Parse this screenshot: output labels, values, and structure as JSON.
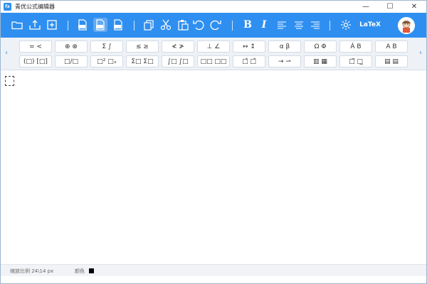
{
  "window": {
    "title": "青优公式编辑器",
    "logo_text": "fx",
    "controls": [
      "—",
      "☐",
      "✕"
    ]
  },
  "toolbar": {
    "icons": [
      "folder-open-icon",
      "export-icon",
      "new-document-icon",
      "save-png-icon",
      "save-svg-icon",
      "save-tex-icon",
      "copy-icon",
      "cut-icon",
      "paste-icon",
      "undo-icon",
      "redo-icon",
      "align-left-icon",
      "align-center-icon",
      "align-right-icon",
      "settings-gear-icon"
    ],
    "bold_label": "B",
    "italic_label": "I",
    "latex_label": "LaTeX",
    "accent_color": "#2f8ff0"
  },
  "palette": {
    "left_arrow": "‹",
    "right_arrow": "›",
    "row1": [
      "= <",
      "⊕ ⊗",
      "Σ ∫",
      "≤ ≥",
      "≮ ≯",
      "⊥ ∠",
      "↔ ↕",
      "α β",
      "Ω Φ",
      "Ȧ B",
      "A B"
    ],
    "row2": [
      "(□) [□]",
      "□/□",
      "□² □ₓ",
      "Σ□ Σ□",
      "∫□ ∫□",
      "□□ □□",
      "□̂ □̃",
      "→ ⇀",
      "▥ ▦",
      "□̅ □̲",
      "▤ ▤"
    ]
  },
  "status": {
    "zoom_text": "缩放比例 24\\14 px",
    "color_label": "颜色",
    "current_color": "#000000"
  }
}
